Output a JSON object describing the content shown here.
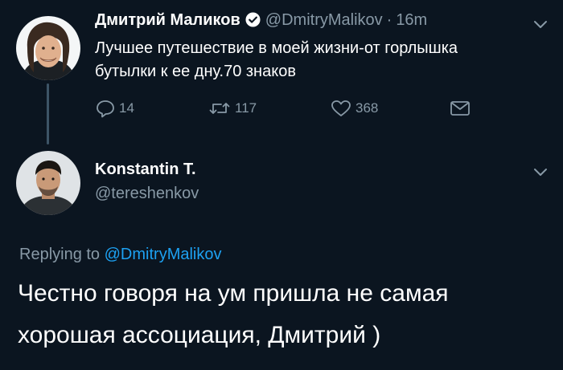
{
  "tweet": {
    "author_name": "Дмитрий Маликов",
    "author_handle": "@DmitryMalikov",
    "separator": "·",
    "time": "16m",
    "text": "Лучшее путешествие в моей жизни-от горлышка бутылки к ее дну.70 знаков",
    "actions": {
      "reply_count": "14",
      "retweet_count": "117",
      "like_count": "368"
    }
  },
  "reply": {
    "author_name": "Konstantin T.",
    "author_handle": "@tereshenkov",
    "replying_prefix": "Replying to",
    "replying_to": "@DmitryMalikov",
    "text": "Честно говоря на ум пришла не самая хорошая ассоциация, Дмитрий )"
  },
  "icons": [
    "verified-badge-icon",
    "chevron-down-icon",
    "reply-icon",
    "retweet-icon",
    "like-icon",
    "direct-message-icon"
  ],
  "colors": {
    "background": "#0b1520",
    "muted": "#8899a6",
    "accent": "#1da1f2",
    "text": "#ffffff"
  }
}
